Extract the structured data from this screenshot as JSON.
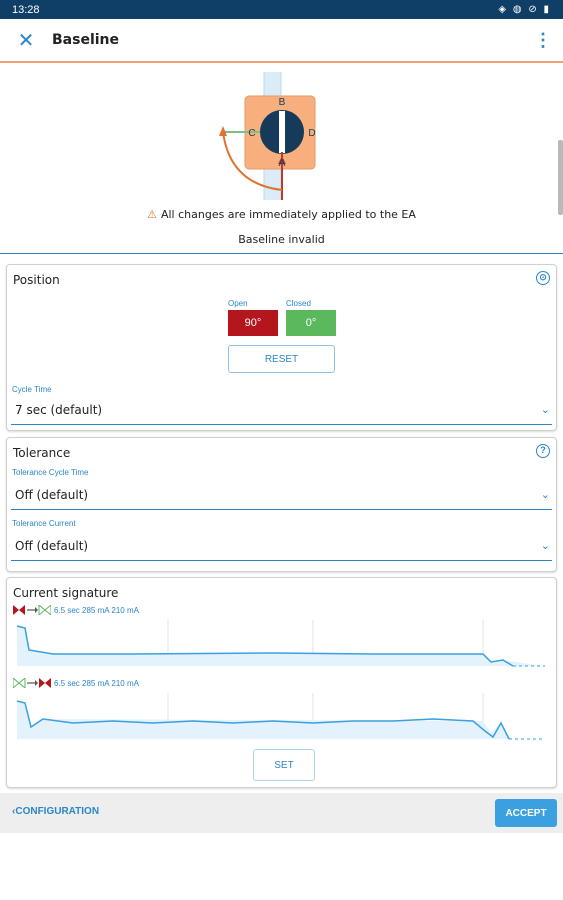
{
  "status_bar": {
    "time": "13:28",
    "icons": "◈ ◍ ⊘ ▮"
  },
  "app_bar": {
    "close_icon": "✕",
    "title": "Baseline",
    "more_icon": "⋮"
  },
  "valve": {
    "labels": [
      "B",
      "C",
      "D",
      "A"
    ]
  },
  "notice": {
    "warning_text": "All changes are immediately applied to the EA",
    "baseline_status": "Baseline invalid"
  },
  "position": {
    "title": "Position",
    "open_label": "Open",
    "open_value": "90°",
    "closed_label": "Closed",
    "closed_value": "0°",
    "reset_label": "RESET",
    "cycle_time_label": "Cycle Time",
    "cycle_time_value": "7 sec (default)",
    "colors": {
      "open": "#b3161c",
      "closed": "#5cb85c"
    }
  },
  "tolerance": {
    "title": "Tolerance",
    "cycle_label": "Tolerance Cycle Time",
    "cycle_value": "Off (default)",
    "current_label": "Tolerance Current",
    "current_value": "Off (default)"
  },
  "signature": {
    "title": "Current signature",
    "open_to_close": "6.5 sec 285 mA 210 mA",
    "close_to_open": "6.5 sec 285 mA 210 mA",
    "set_label": "SET"
  },
  "footer": {
    "back_label": "CONFIGURATION",
    "accept_label": "ACCEPT"
  },
  "colors": {
    "accent": "#2a86c8",
    "header_border": "#f0a070",
    "statusbar": "#0f3f66",
    "valve_body": "#f7b07d"
  }
}
